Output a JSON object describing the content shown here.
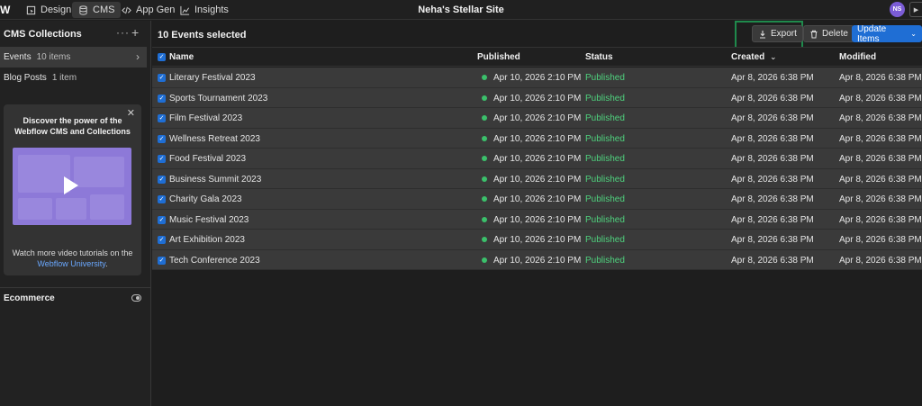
{
  "nav": {
    "tabs": [
      {
        "label": "Design",
        "icon": "design-icon"
      },
      {
        "label": "CMS",
        "icon": "database-icon"
      },
      {
        "label": "App Gen",
        "icon": "code-icon"
      },
      {
        "label": "Insights",
        "icon": "chart-icon"
      }
    ],
    "site_name": "Neha's Stellar Site",
    "avatar_initials": "NS"
  },
  "sidebar": {
    "title": "CMS Collections",
    "collections": [
      {
        "name": "Events",
        "count": "10 items"
      },
      {
        "name": "Blog Posts",
        "count": "1 item"
      }
    ],
    "promo": {
      "title": "Discover the power of the Webflow CMS and Collections",
      "footer_text": "Watch more video tutorials on the",
      "link_text": "Webflow University",
      "footer_end": "."
    },
    "ecommerce_label": "Ecommerce"
  },
  "main": {
    "selection_title": "10 Events selected",
    "export_label": "Export",
    "delete_label": "Delete",
    "update_label": "Update Items",
    "columns": {
      "name": "Name",
      "published": "Published",
      "status": "Status",
      "created": "Created",
      "modified": "Modified"
    },
    "rows": [
      {
        "name": "Literary Festival 2023",
        "published": "Apr 10, 2026 2:10 PM",
        "status": "Published",
        "created": "Apr 8, 2026 6:38 PM",
        "modified": "Apr 8, 2026 6:38 PM"
      },
      {
        "name": "Sports Tournament 2023",
        "published": "Apr 10, 2026 2:10 PM",
        "status": "Published",
        "created": "Apr 8, 2026 6:38 PM",
        "modified": "Apr 8, 2026 6:38 PM"
      },
      {
        "name": "Film Festival 2023",
        "published": "Apr 10, 2026 2:10 PM",
        "status": "Published",
        "created": "Apr 8, 2026 6:38 PM",
        "modified": "Apr 8, 2026 6:38 PM"
      },
      {
        "name": "Wellness Retreat 2023",
        "published": "Apr 10, 2026 2:10 PM",
        "status": "Published",
        "created": "Apr 8, 2026 6:38 PM",
        "modified": "Apr 8, 2026 6:38 PM"
      },
      {
        "name": "Food Festival 2023",
        "published": "Apr 10, 2026 2:10 PM",
        "status": "Published",
        "created": "Apr 8, 2026 6:38 PM",
        "modified": "Apr 8, 2026 6:38 PM"
      },
      {
        "name": "Business Summit 2023",
        "published": "Apr 10, 2026 2:10 PM",
        "status": "Published",
        "created": "Apr 8, 2026 6:38 PM",
        "modified": "Apr 8, 2026 6:38 PM"
      },
      {
        "name": "Charity Gala 2023",
        "published": "Apr 10, 2026 2:10 PM",
        "status": "Published",
        "created": "Apr 8, 2026 6:38 PM",
        "modified": "Apr 8, 2026 6:38 PM"
      },
      {
        "name": "Music Festival 2023",
        "published": "Apr 10, 2026 2:10 PM",
        "status": "Published",
        "created": "Apr 8, 2026 6:38 PM",
        "modified": "Apr 8, 2026 6:38 PM"
      },
      {
        "name": "Art Exhibition 2023",
        "published": "Apr 10, 2026 2:10 PM",
        "status": "Published",
        "created": "Apr 8, 2026 6:38 PM",
        "modified": "Apr 8, 2026 6:38 PM"
      },
      {
        "name": "Tech Conference 2023",
        "published": "Apr 10, 2026 2:10 PM",
        "status": "Published",
        "created": "Apr 8, 2026 6:38 PM",
        "modified": "Apr 8, 2026 6:38 PM"
      }
    ]
  },
  "colors": {
    "accent": "#1f6ed4",
    "published_status": "#4fd27e",
    "highlight_box": "#1f8a4c"
  }
}
